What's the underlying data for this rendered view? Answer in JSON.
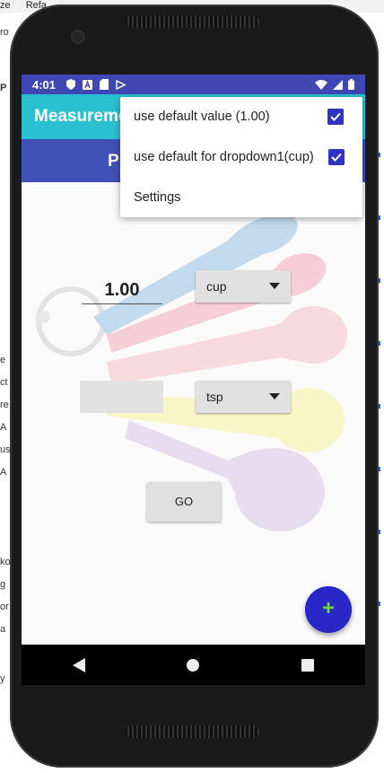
{
  "background_ide": {
    "menu_fragments": [
      "ze",
      "Refa"
    ],
    "left_fragments": [
      "ro",
      "P",
      "e",
      "ct",
      "re",
      "A",
      "us",
      "A",
      "ko",
      "g",
      "or",
      "a",
      "y"
    ]
  },
  "status_bar": {
    "time": "4:01",
    "icons": [
      "shield-icon",
      "a-icon",
      "sd-card-icon",
      "play-icon",
      "wifi-icon",
      "signal-icon",
      "battery-icon"
    ]
  },
  "app_bar": {
    "title": "Measureme",
    "color": "#2bc0cf"
  },
  "sub_bar": {
    "label": "P",
    "color": "#3f51b5"
  },
  "main": {
    "value_display": "1.00",
    "from_unit": "cup",
    "to_unit": "tsp",
    "input_value": "",
    "go_label": "GO",
    "fab_label": "+"
  },
  "overflow_menu": {
    "items": [
      {
        "label": "use default value (1.00)",
        "checked": true
      },
      {
        "label": "use default for dropdown1(cup)",
        "checked": true
      },
      {
        "label": "Settings",
        "checked": null
      }
    ]
  },
  "nav_bar": {
    "icons": [
      "back-icon",
      "home-icon",
      "recents-icon"
    ]
  },
  "colors": {
    "accent": "#2f35c1",
    "fab": "#2a27c9",
    "status_bar": "#3f47b5"
  }
}
